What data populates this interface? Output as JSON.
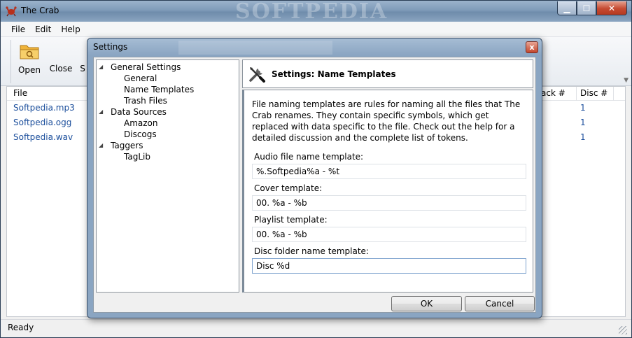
{
  "window": {
    "title": "The Crab",
    "watermark": "SOFTPEDIA",
    "caption": {
      "minimize": "▁",
      "maximize": "☐",
      "close": "✕"
    }
  },
  "menu": [
    "File",
    "Edit",
    "Help"
  ],
  "toolbar": {
    "open_label": "Open",
    "close_label": "Close",
    "third_label": "S"
  },
  "file_list": {
    "columns": {
      "file": "File",
      "track": "ack #",
      "disc": "Disc #"
    },
    "rows": [
      {
        "file": "Softpedia.mp3",
        "disc": "1"
      },
      {
        "file": "Softpedia.ogg",
        "disc": "1"
      },
      {
        "file": "Softpedia.wav",
        "disc": "1"
      }
    ]
  },
  "status": "Ready",
  "dialog": {
    "title": "Settings",
    "close": "x",
    "tree": {
      "general_settings": "General Settings",
      "general": "General",
      "name_templates": "Name Templates",
      "trash_files": "Trash Files",
      "data_sources": "Data Sources",
      "amazon": "Amazon",
      "discogs": "Discogs",
      "taggers": "Taggers",
      "taglib": "TagLib"
    },
    "panel_title": "Settings: Name Templates",
    "description": "File naming templates are rules for naming all the files that The Crab renames. They contain specific symbols, which get replaced with data specific to the file. Check out the help for a detailed discussion and the complete list of tokens.",
    "fields": {
      "audio_label": "Audio file name template:",
      "audio_value": "%.Softpedia%a - %t",
      "cover_label": "Cover template:",
      "cover_value": "00. %a - %b",
      "playlist_label": "Playlist template:",
      "playlist_value": "00. %a - %b",
      "disc_label": "Disc folder name template:",
      "disc_value": "Disc %d"
    },
    "ok_label": "OK",
    "cancel_label": "Cancel"
  }
}
